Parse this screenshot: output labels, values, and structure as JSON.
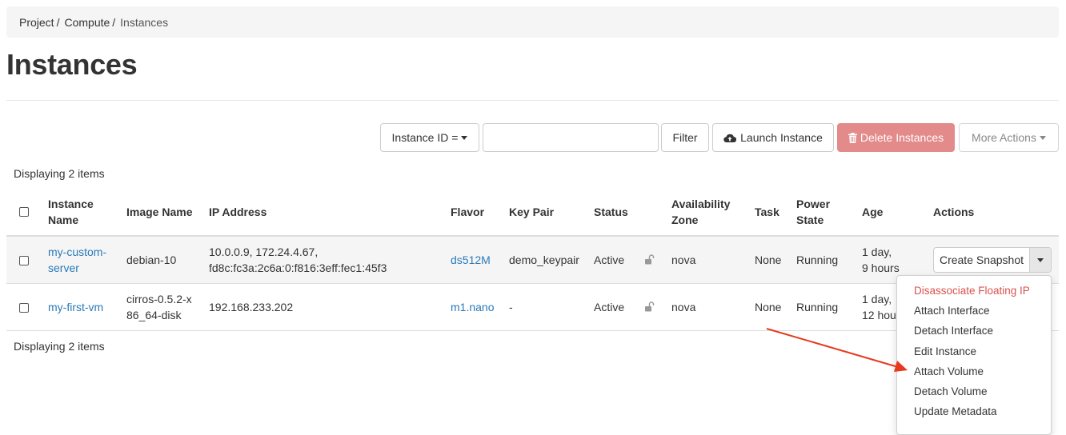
{
  "breadcrumb": {
    "items": [
      "Project",
      "Compute",
      "Instances"
    ],
    "separator": "/"
  },
  "page": {
    "title": "Instances"
  },
  "toolbar": {
    "filter_field_label": "Instance ID =",
    "search_value": "",
    "filter_label": "Filter",
    "launch_label": "Launch Instance",
    "delete_label": "Delete Instances",
    "more_actions_label": "More Actions"
  },
  "table": {
    "display_count": "Displaying 2 items",
    "headers": {
      "instance_name_1": "Instance",
      "instance_name_2": "Name",
      "image_name": "Image Name",
      "ip_address": "IP Address",
      "flavor": "Flavor",
      "key_pair": "Key Pair",
      "status": "Status",
      "az_1": "Availability",
      "az_2": "Zone",
      "task": "Task",
      "power_1": "Power",
      "power_2": "State",
      "age": "Age",
      "actions": "Actions"
    },
    "rows": [
      {
        "name_1": "my-custom-",
        "name_2": "server",
        "image": "debian-10",
        "ip_1": "10.0.0.9, 172.24.4.67,",
        "ip_2": "fd8c:fc3a:2c6a:0:f816:3eff:fec1:45f3",
        "flavor": "ds512M",
        "key_pair": "demo_keypair",
        "status": "Active",
        "az": "nova",
        "task": "None",
        "power": "Running",
        "age_1": "1 day,",
        "age_2": "9 hours",
        "action_label": "Create Snapshot"
      },
      {
        "name": "my-first-vm",
        "image_1": "cirros-0.5.2-x",
        "image_2": "86_64-disk",
        "ip": "192.168.233.202",
        "flavor": "m1.nano",
        "key_pair": "-",
        "status": "Active",
        "az": "nova",
        "task": "None",
        "power": "Running",
        "age_1": "1 day,",
        "age_2": "12 hou"
      }
    ]
  },
  "actions_menu": {
    "items": [
      "Disassociate Floating IP",
      "Attach Interface",
      "Detach Interface",
      "Edit Instance",
      "Attach Volume",
      "Detach Volume",
      "Update Metadata"
    ]
  },
  "colors": {
    "link": "#2a7ab8",
    "danger_button": "#e38a8a",
    "danger_text": "#d9534f",
    "annotation_arrow": "#e8391d"
  },
  "icons": {
    "launch": "cloud-upload-icon",
    "delete": "trash-icon",
    "status_lock": "unlock-icon"
  }
}
